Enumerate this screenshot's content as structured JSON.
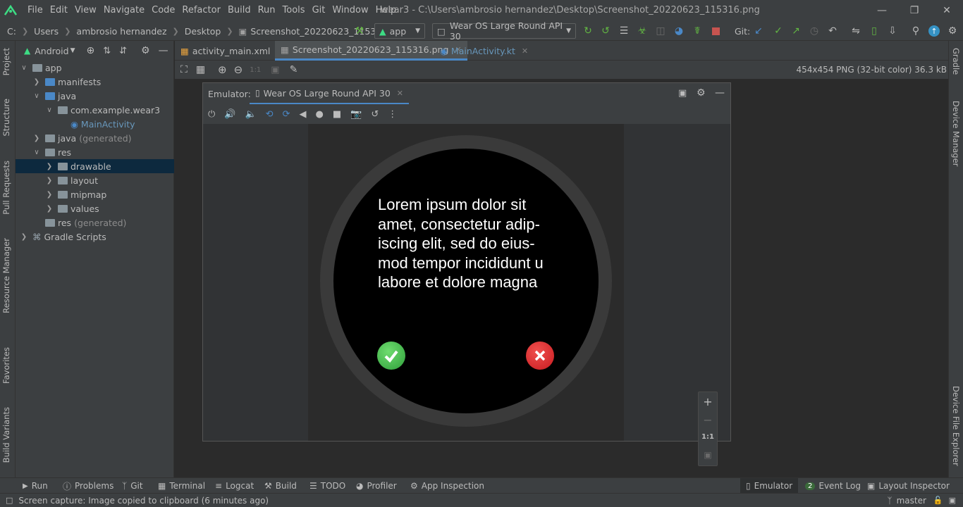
{
  "menu": [
    "File",
    "Edit",
    "View",
    "Navigate",
    "Code",
    "Refactor",
    "Build",
    "Run",
    "Tools",
    "Git",
    "Window",
    "Help"
  ],
  "window_title": "wear3 - C:\\Users\\ambrosio hernandez\\Desktop\\Screenshot_20220623_115316.png",
  "breadcrumbs": [
    "C:",
    "Users",
    "ambrosio hernandez",
    "Desktop",
    "Screenshot_20220623_115316.png"
  ],
  "toolbar": {
    "run_config": "app",
    "device": "Wear OS Large Round API 30",
    "git_label": "Git:"
  },
  "project_panel": {
    "view_mode": "Android",
    "tree": [
      {
        "label": "app",
        "indent": 0,
        "expanded": true
      },
      {
        "label": "manifests",
        "indent": 1,
        "expanded": false
      },
      {
        "label": "java",
        "indent": 1,
        "expanded": true
      },
      {
        "label": "com.example.wear3",
        "indent": 2,
        "expanded": true
      },
      {
        "label": "MainActivity",
        "indent": 3
      },
      {
        "label": "java",
        "suffix": "(generated)",
        "indent": 1,
        "expanded": false
      },
      {
        "label": "res",
        "indent": 1,
        "expanded": true
      },
      {
        "label": "drawable",
        "indent": 2,
        "expanded": false,
        "selected": true
      },
      {
        "label": "layout",
        "indent": 2,
        "expanded": false
      },
      {
        "label": "mipmap",
        "indent": 2,
        "expanded": false
      },
      {
        "label": "values",
        "indent": 2,
        "expanded": false
      },
      {
        "label": "res",
        "suffix": "(generated)",
        "indent": 1
      },
      {
        "label": "Gradle Scripts",
        "indent": 0,
        "expanded": false
      }
    ]
  },
  "editor_tabs": [
    {
      "label": "activity_main.xml",
      "active": false
    },
    {
      "label": "Screenshot_20220623_115316.png",
      "active": true
    },
    {
      "label": "MainActivity.kt",
      "active": false
    }
  ],
  "image_info": "454x454 PNG (32-bit color) 36.3 kB",
  "emulator": {
    "label": "Emulator:",
    "tab": "Wear OS Large Round API 30",
    "screen_text": "Lorem ipsum dolor sit\namet, consectetur adip-\niscing elit, sed do eius-\nmod tempor incididunt u\nlabore et dolore magna",
    "zoom": {
      "plus": "+",
      "minus": "−",
      "ratio": "1:1"
    }
  },
  "left_strip": [
    "Project",
    "Structure",
    "Pull Requests",
    "Resource Manager",
    "Favorites",
    "Build Variants"
  ],
  "right_strip": [
    "Gradle",
    "Device Manager",
    "Device File Explorer"
  ],
  "bottom_tabs": [
    {
      "label": "Run"
    },
    {
      "label": "Problems"
    },
    {
      "label": "Git"
    },
    {
      "label": "Terminal"
    },
    {
      "label": "Logcat"
    },
    {
      "label": "Build"
    },
    {
      "label": "TODO"
    },
    {
      "label": "Profiler"
    },
    {
      "label": "App Inspection"
    }
  ],
  "bottom_right_tabs": [
    {
      "label": "Emulator",
      "active": true
    },
    {
      "label": "Event Log",
      "badge": "2"
    },
    {
      "label": "Layout Inspector"
    }
  ],
  "status": {
    "message": "Screen capture: Image copied to clipboard (6 minutes ago)",
    "branch": "master"
  },
  "colors": {
    "accent": "#4a88c7",
    "selection": "#0d293e",
    "ok_green": "#3ab54a",
    "cancel_red": "#e4222a"
  }
}
